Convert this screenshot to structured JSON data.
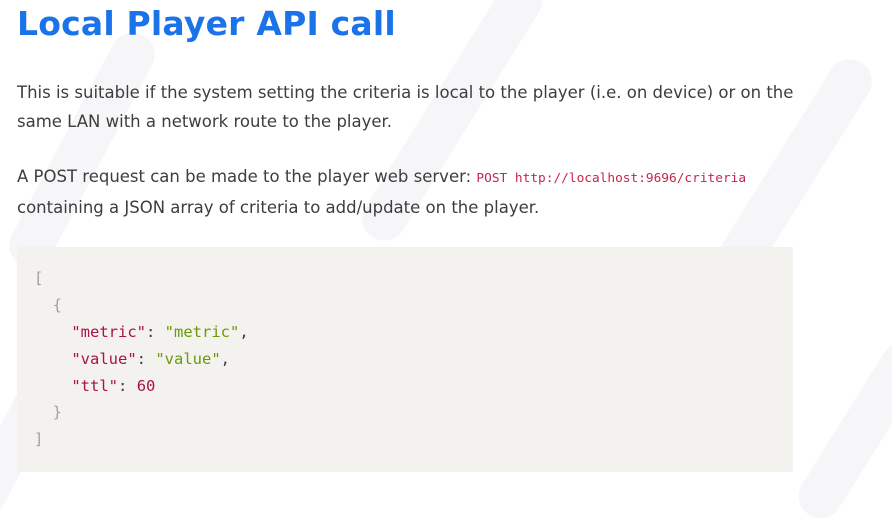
{
  "page": {
    "title": "Local Player API call",
    "intro": "This is suitable if the system setting the criteria is local to the player (i.e. on device) or on the same LAN with a network route to the player.",
    "post_text_before": "A POST request can be made to the player web server: ",
    "post_code": "POST http://localhost:9696/criteria",
    "post_text_after": "containing a JSON array of criteria to add/update on the player."
  },
  "code_block": {
    "open_bracket": "[",
    "open_brace": "{",
    "fields": [
      {
        "key": "\"metric\"",
        "value": "\"metric\"",
        "trailing": ","
      },
      {
        "key": "\"value\"",
        "value": "\"value\"",
        "trailing": ","
      },
      {
        "key": "\"ttl\"",
        "value": "60",
        "trailing": ""
      }
    ],
    "colon": ":",
    "close_brace": "}",
    "close_bracket": "]"
  },
  "colors": {
    "heading": "#1a73e8",
    "inline_code": "#c7254e",
    "json_key": "#a8124c",
    "json_string": "#6a9a0c",
    "json_number": "#a8124c",
    "code_background": "#f4f2ef"
  }
}
